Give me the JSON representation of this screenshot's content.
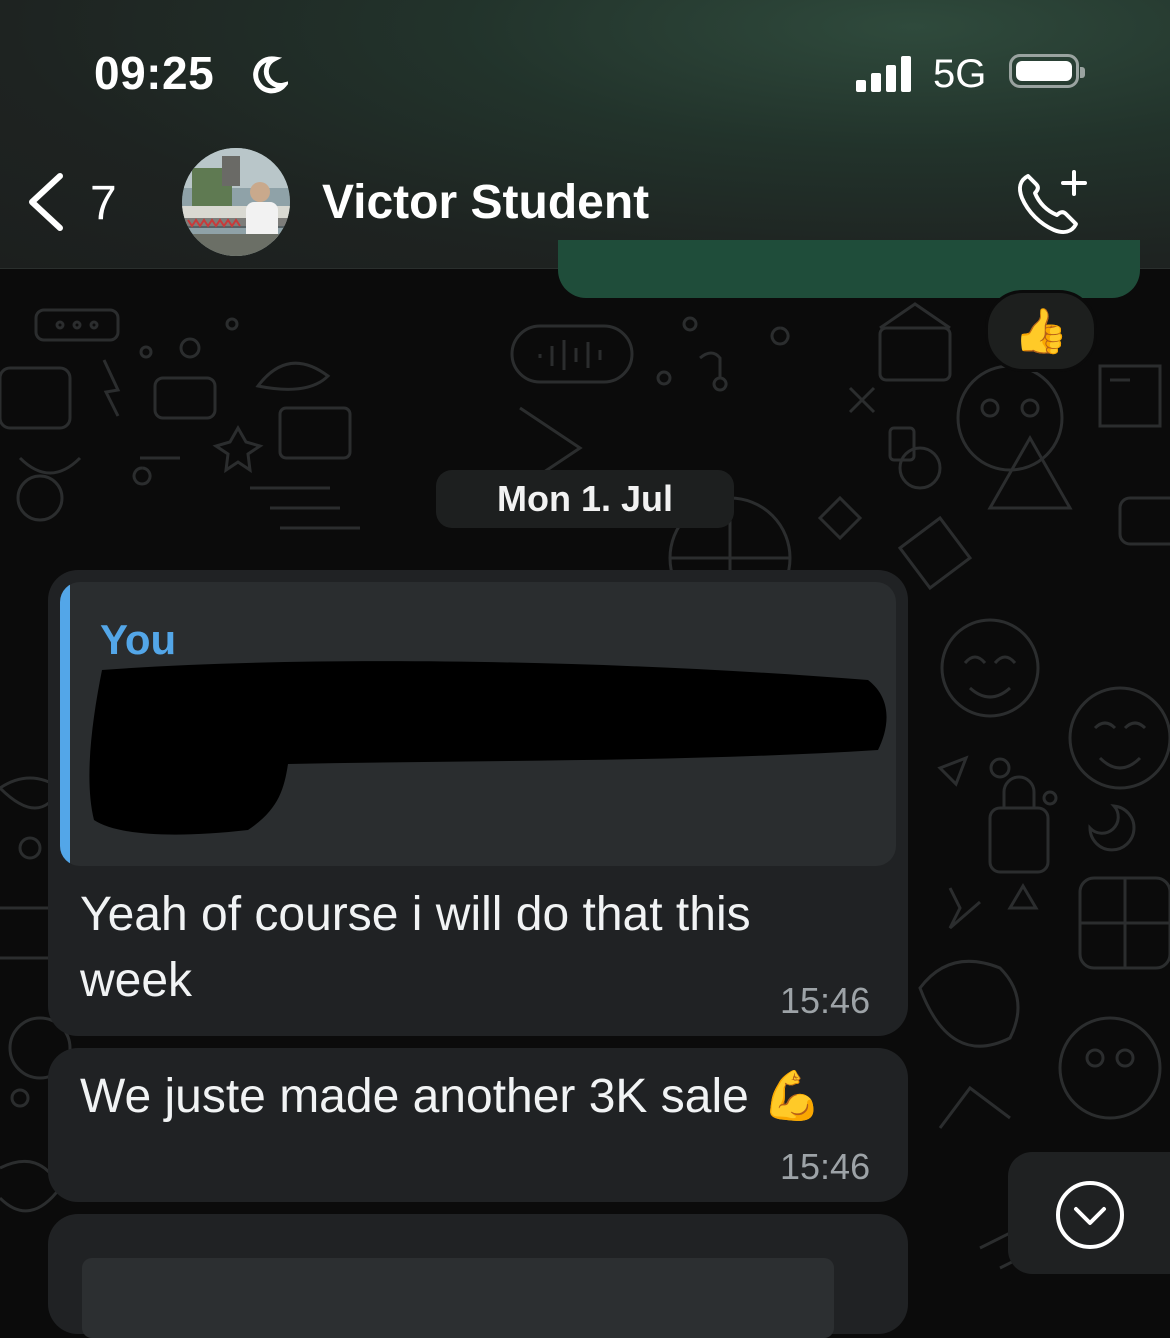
{
  "status_bar": {
    "time": "09:25",
    "network": "5G",
    "moon_icon": "moon-icon",
    "signal_bars": 4,
    "battery_level": 1.0
  },
  "header": {
    "back_count": "7",
    "contact_name": "Victor Student",
    "call_icon": "phone-plus-icon"
  },
  "previous_message": {
    "reaction": "👍"
  },
  "date_separator": "Mon 1. Jul",
  "messages": [
    {
      "quote_author": "You",
      "text": "Yeah of course i will do that this week",
      "time": "15:46"
    },
    {
      "text": "We juste made another 3K sale 💪",
      "time": "15:46"
    }
  ],
  "colors": {
    "accent_blue": "#53a6e8",
    "outgoing_bubble": "#1f4d3a",
    "incoming_bubble": "#202224",
    "background": "#0b0b0b"
  }
}
